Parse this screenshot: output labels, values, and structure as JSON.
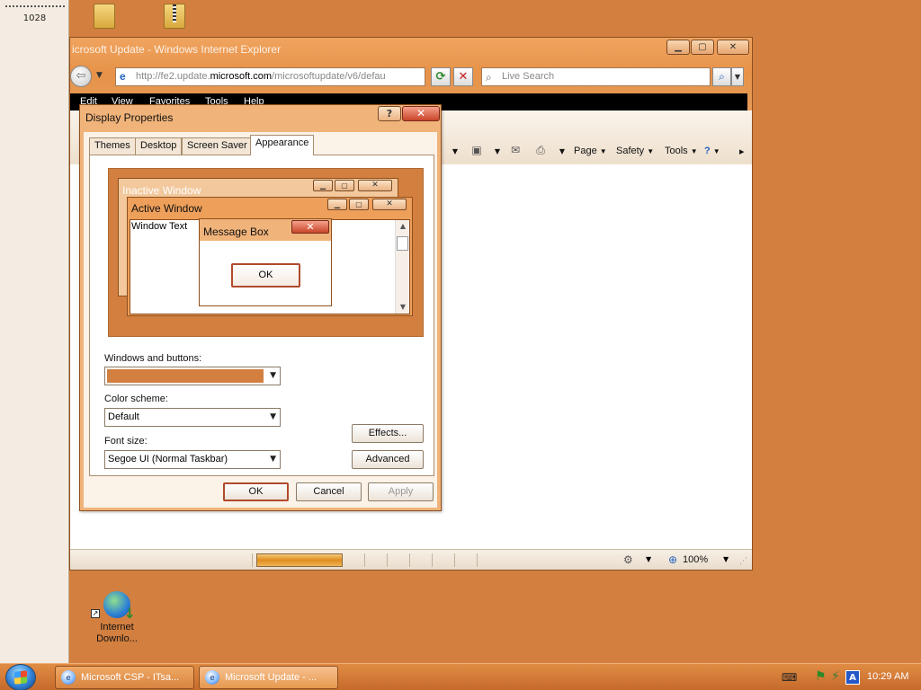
{
  "sidebar": {
    "counter": "1028"
  },
  "desktop": {
    "icons": [
      {
        "name": "folder"
      },
      {
        "name": "zip-folder"
      }
    ],
    "ie_shortcut_label": "Internet Downlo..."
  },
  "ie": {
    "title": "icrosoft Update - Windows Internet Explorer",
    "address": {
      "prefix": "http://fe2.update.",
      "domain": "microsoft.com",
      "suffix": "/microsoftupdate/v6/defau"
    },
    "search_placeholder": "Live Search",
    "menu": [
      "Edit",
      "View",
      "Favorites",
      "Tools",
      "Help"
    ],
    "toolbar": {
      "page": "Page",
      "safety": "Safety",
      "tools": "Tools"
    },
    "progress": 1.0,
    "zoom": "100%"
  },
  "dialog": {
    "title": "Display Properties",
    "tabs": [
      "Themes",
      "Desktop",
      "Screen Saver",
      "Appearance"
    ],
    "active_tab": "Appearance",
    "preview": {
      "inactive_title": "Inactive Window",
      "active_title": "Active Window",
      "window_text": "Window Text",
      "message_title": "Message Box",
      "message_ok": "OK"
    },
    "windows_buttons_label": "Windows and buttons:",
    "windows_buttons_color": "#d27f3f",
    "color_scheme_label": "Color scheme:",
    "color_scheme_value": "Default",
    "font_size_label": "Font size:",
    "font_size_value": "Segoe UI (Normal Taskbar)",
    "effects_label": "Effects...",
    "advanced_label": "Advanced",
    "ok_label": "OK",
    "cancel_label": "Cancel",
    "apply_label": "Apply"
  },
  "taskbar": {
    "tasks": [
      {
        "label": "Microsoft CSP - ITsa..."
      },
      {
        "label": "Microsoft Update - ..."
      }
    ],
    "lang": "A",
    "clock": "10:29 AM"
  },
  "colors": {
    "desktop": "#d27f3f",
    "accent": "#e79248",
    "close_red": "#c8452a"
  }
}
